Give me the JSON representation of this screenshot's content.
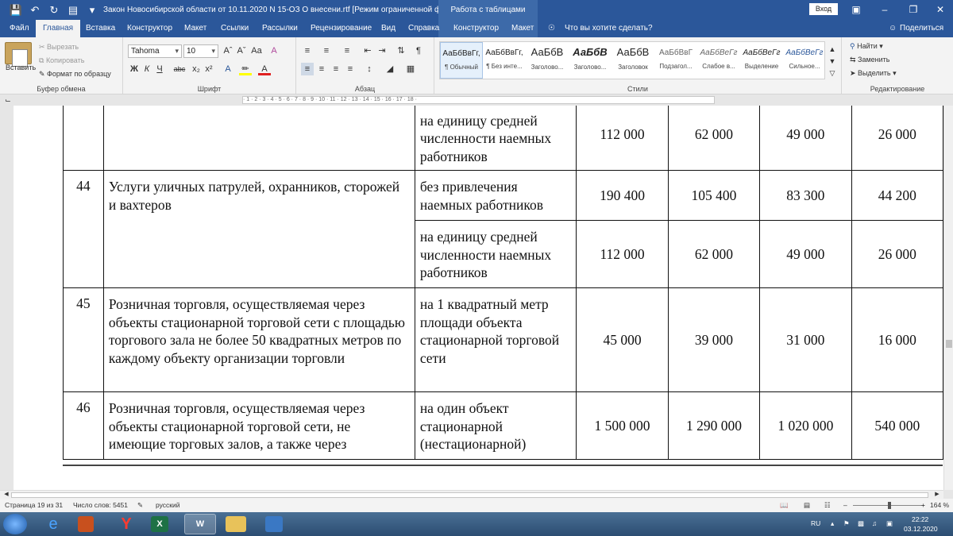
{
  "window": {
    "title": "Закон Новосибирской области от 10.11.2020 N 15-ОЗ  О внесени.rtf [Режим ограниченной функцио...",
    "context_group": "Работа с таблицами",
    "login_label": "Вход"
  },
  "tabs": [
    "Файл",
    "Главная",
    "Вставка",
    "Конструктор",
    "Макет",
    "Ссылки",
    "Рассылки",
    "Рецензирование",
    "Вид",
    "Справка",
    "Конструктор",
    "Макет"
  ],
  "tell_me": "Что вы хотите сделать?",
  "share": "Поделиться",
  "ribbon": {
    "clipboard": {
      "paste": "Вставить",
      "cut": "Вырезать",
      "copy": "Копировать",
      "format_painter": "Формат по образцу",
      "label": "Буфер обмена"
    },
    "font": {
      "name": "Tahoma",
      "size": "10",
      "label": "Шрифт",
      "bold": "Ж",
      "italic": "К",
      "underline": "Ч",
      "strike": "abc"
    },
    "paragraph": {
      "label": "Абзац"
    },
    "styles": {
      "label": "Стили",
      "items": [
        {
          "sample": "АаБбВвГг,",
          "name": "¶ Обычный"
        },
        {
          "sample": "АаБбВвГг,",
          "name": "¶ Без инте..."
        },
        {
          "sample": "АаБбВ",
          "name": "Заголово..."
        },
        {
          "sample": "АаБбВ",
          "name": "Заголово..."
        },
        {
          "sample": "АаБбВ",
          "name": "Заголовок"
        },
        {
          "sample": "АаБбВвГ",
          "name": "Подзагол..."
        },
        {
          "sample": "АаБбВеГг",
          "name": "Слабое в..."
        },
        {
          "sample": "АаБбВеГг",
          "name": "Выделение"
        },
        {
          "sample": "АаБбВеГг",
          "name": "Сильное..."
        }
      ]
    },
    "editing": {
      "find": "Найти",
      "replace": "Заменить",
      "select": "Выделить",
      "label": "Редактирование"
    }
  },
  "table_rows": [
    {
      "idx": "",
      "activity": "",
      "unit": "на единицу средней численности наемных работников",
      "v1": "112 000",
      "v2": "62 000",
      "v3": "49 000",
      "v4": "26 000"
    },
    {
      "idx": "44",
      "activity": "Услуги уличных патрулей, охранников, сторожей и вахтеров",
      "unit": "без привлечения наемных работников",
      "v1": "190 400",
      "v2": "105 400",
      "v3": "83 300",
      "v4": "44 200"
    },
    {
      "unit": "на единицу средней численности наемных работников",
      "v1": "112 000",
      "v2": "62 000",
      "v3": "49 000",
      "v4": "26 000"
    },
    {
      "idx": "45",
      "activity": "Розничная торговля, осуществляемая через объекты стационарной торговой сети с площадью торгового зала не более 50 квадратных метров по каждому объекту организации торговли",
      "unit": "на 1 квадратный метр площади объекта стационарной торговой сети",
      "v1": "45 000",
      "v2": "39 000",
      "v3": "31 000",
      "v4": "16 000"
    },
    {
      "idx": "46",
      "activity": "Розничная торговля, осуществляемая через объекты стационарной торговой сети, не имеющие торговых залов, а также через",
      "unit": "на один объект стационарной (нестационарной)",
      "v1": "1 500 000",
      "v2": "1 290 000",
      "v3": "1 020 000",
      "v4": "540 000"
    }
  ],
  "status": {
    "page": "Страница 19 из 31",
    "words": "Число слов: 5451",
    "lang": "русский",
    "zoom": "164 %"
  },
  "taskbar": {
    "lang": "RU",
    "time": "22:22",
    "date": "03.12.2020"
  }
}
